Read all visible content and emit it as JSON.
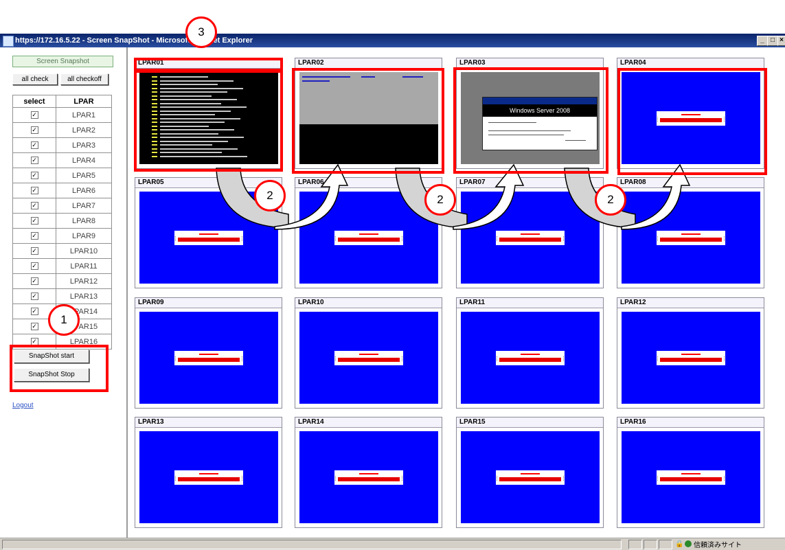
{
  "window": {
    "title": "https://172.16.5.22 - Screen SnapShot - Microsoft Internet Explorer",
    "status_zone": "信頼済みサイト"
  },
  "left": {
    "snap_title": "Screen Snapshot",
    "all_check": "all check",
    "all_checkoff": "all checkoff",
    "col_select": "select",
    "col_lpar": "LPAR",
    "rows": [
      "LPAR1",
      "LPAR2",
      "LPAR3",
      "LPAR4",
      "LPAR5",
      "LPAR6",
      "LPAR7",
      "LPAR8",
      "LPAR9",
      "LPAR10",
      "LPAR11",
      "LPAR12",
      "LPAR13",
      "LPAR14",
      "LPAR15",
      "LPAR16"
    ],
    "check_mark": "✓",
    "snapshot_start": "SnapShot start",
    "snapshot_stop": "SnapShot Stop",
    "logout": "Logout"
  },
  "panels": [
    "LPAR01",
    "LPAR02",
    "LPAR03",
    "LPAR04",
    "LPAR05",
    "LPAR06",
    "LPAR07",
    "LPAR08",
    "LPAR09",
    "LPAR10",
    "LPAR11",
    "LPAR12",
    "LPAR13",
    "LPAR14",
    "LPAR15",
    "LPAR16"
  ],
  "lpar03_screen": {
    "product": "Windows Server 2008"
  },
  "callouts": {
    "one": "1",
    "two": "2",
    "three": "3"
  },
  "colors": {
    "annotation_red": "#ff0000",
    "screen_blue": "#0000ff",
    "titlebar": "#0a246a"
  }
}
